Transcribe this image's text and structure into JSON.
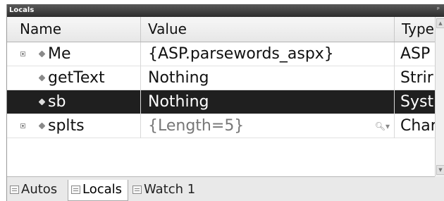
{
  "window": {
    "title": "Locals",
    "pin_glyph": "ᵖ"
  },
  "columns": {
    "name": "Name",
    "value": "Value",
    "type": "Type"
  },
  "rows": [
    {
      "name": "Me",
      "value": "{ASP.parsewords_aspx}",
      "type": "ASP",
      "expandable": true,
      "selected": false
    },
    {
      "name": "getText",
      "value": "Nothing",
      "type": "Strir",
      "expandable": false,
      "selected": false
    },
    {
      "name": "sb",
      "value": "Nothing",
      "type": "Syst",
      "expandable": false,
      "selected": true
    },
    {
      "name": "splts",
      "value": "{Length=5}",
      "type": "Char",
      "expandable": true,
      "selected": false,
      "value_dimmed": true,
      "has_visualizer": true
    }
  ],
  "tabs": [
    {
      "label": "Autos",
      "active": false
    },
    {
      "label": "Locals",
      "active": true
    },
    {
      "label": "Watch 1",
      "active": false
    }
  ],
  "icons": {
    "variable": "variable-icon",
    "expand": "expand-icon",
    "visualizer": "magnifier-icon",
    "tab": "tab-window-icon"
  },
  "colors": {
    "selection": "#1f1f1f",
    "titlebar": "#3a3a3a"
  }
}
